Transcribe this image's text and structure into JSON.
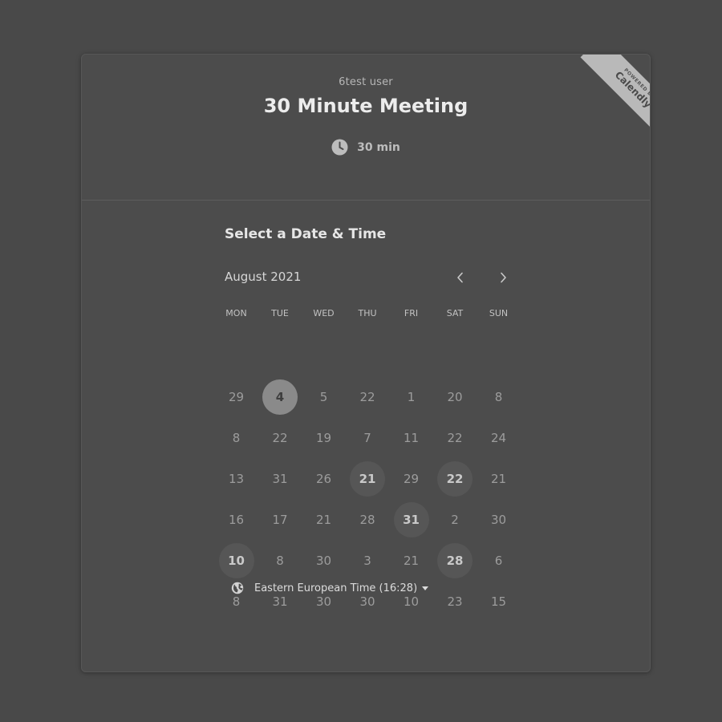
{
  "header": {
    "owner": "6test user",
    "event_title": "30 Minute Meeting",
    "duration": "30 min",
    "duration_icon": "clock-icon"
  },
  "badge": {
    "powered_by": "POWERED BY",
    "brand": "Calendly"
  },
  "calendar": {
    "section_title": "Select a Date & Time",
    "month": "August 2021",
    "prev_icon": "chevron-left-icon",
    "next_icon": "chevron-right-icon",
    "weekdays": [
      "MON",
      "TUE",
      "WED",
      "THU",
      "FRI",
      "SAT",
      "SUN"
    ],
    "weeks": [
      [
        {
          "d": "29"
        },
        {
          "d": "4",
          "state": "selected"
        },
        {
          "d": "5"
        },
        {
          "d": "22"
        },
        {
          "d": "1"
        },
        {
          "d": "20"
        },
        {
          "d": "8"
        }
      ],
      [
        {
          "d": "8"
        },
        {
          "d": "22"
        },
        {
          "d": "19"
        },
        {
          "d": "7"
        },
        {
          "d": "11"
        },
        {
          "d": "22"
        },
        {
          "d": "24"
        }
      ],
      [
        {
          "d": "13"
        },
        {
          "d": "31"
        },
        {
          "d": "26"
        },
        {
          "d": "21",
          "state": "available"
        },
        {
          "d": "29"
        },
        {
          "d": "22",
          "state": "available"
        },
        {
          "d": "21"
        }
      ],
      [
        {
          "d": "16"
        },
        {
          "d": "17"
        },
        {
          "d": "21"
        },
        {
          "d": "28"
        },
        {
          "d": "31",
          "state": "available"
        },
        {
          "d": "2"
        },
        {
          "d": "30"
        }
      ],
      [
        {
          "d": "10",
          "state": "available"
        },
        {
          "d": "8"
        },
        {
          "d": "30"
        },
        {
          "d": "3"
        },
        {
          "d": "21"
        },
        {
          "d": "28",
          "state": "available"
        },
        {
          "d": "6"
        }
      ],
      [
        {
          "d": "8"
        },
        {
          "d": "31"
        },
        {
          "d": "30"
        },
        {
          "d": "30"
        },
        {
          "d": "10"
        },
        {
          "d": "23"
        },
        {
          "d": "15"
        }
      ]
    ]
  },
  "timezone": {
    "label": "Eastern European Time (16:28)",
    "icon": "globe-icon"
  }
}
